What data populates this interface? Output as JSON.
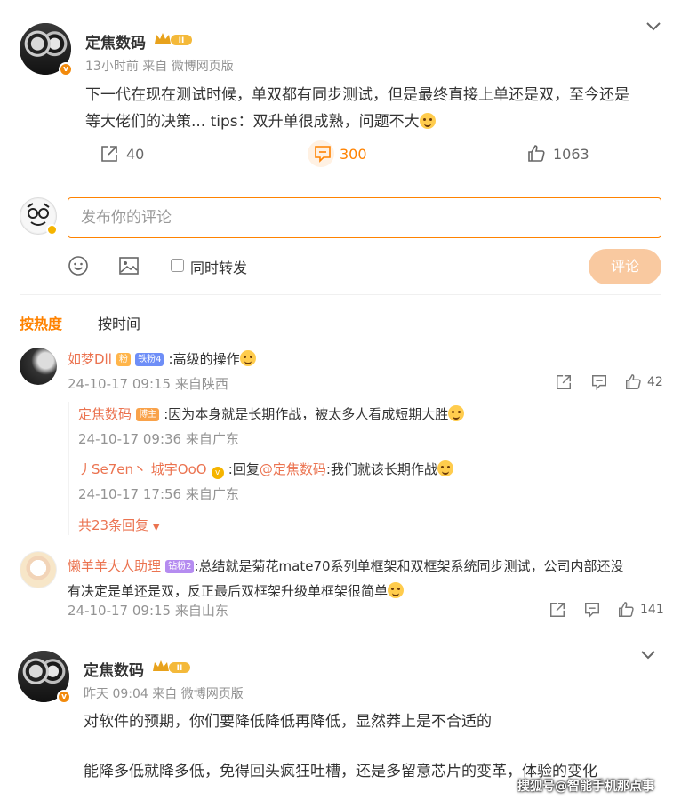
{
  "post1": {
    "author": "定焦数码",
    "time": "13小时前",
    "source": "来自 微博网页版",
    "text_line1": "下一代在现在测试时候，单双都有同步测试，但是最终直接上单还是双，至今还是",
    "text_line2": "等大佬们的决策... tips：双升单很成熟，问题不大",
    "reposts": "40",
    "comments": "300",
    "likes": "1063"
  },
  "composer": {
    "placeholder": "发布你的评论",
    "repost_label": "同时转发",
    "submit_label": "评论"
  },
  "sort_tabs": {
    "hot": "按热度",
    "time": "按时间"
  },
  "comment1": {
    "name": "如梦Dll",
    "badge": "铁粉4",
    "text": ":高级的操作",
    "meta": "24-10-17 09:15 来自陕西",
    "likes": "42",
    "replies": [
      {
        "name": "定焦数码",
        "badge": "博主",
        "text": ":因为本身就是长期作战，被太多人看成短期大胜",
        "meta": "24-10-17 09:36 来自广东"
      },
      {
        "name": "丿Se7en丶 城宇OoO",
        "text_prefix": " :回复",
        "mention": "@定焦数码",
        "text": ":我们就该长期作战",
        "meta": "24-10-17 17:56 来自广东"
      }
    ],
    "more_replies": "共23条回复"
  },
  "comment2": {
    "name": "懒羊羊大人助理",
    "badge": "钻粉2",
    "text_line1": ":总结就是菊花mate70系列单框架和双框架系统同步测试，公司内部还没",
    "text_line2": "有决定是单还是双，反正最后双框架升级单框架很简单",
    "meta": "24-10-17 09:15 来自山东",
    "likes": "141"
  },
  "post2": {
    "author": "定焦数码",
    "time": "昨天 09:04",
    "source": "来自 微博网页版",
    "text_line1": "对软件的预期，你们要降低降低再降低，显然莽上是不合适的",
    "text_line2": "能降多低就降多低，免得回头疯狂吐槽，还是多留意芯片的变革，体验的变化"
  },
  "watermark": "搜狐号@智能手机那点事",
  "colors": {
    "accent": "#ff8200",
    "name": "#eb7350",
    "meta": "#939393",
    "submit_disabled": "#f9c9a0"
  }
}
